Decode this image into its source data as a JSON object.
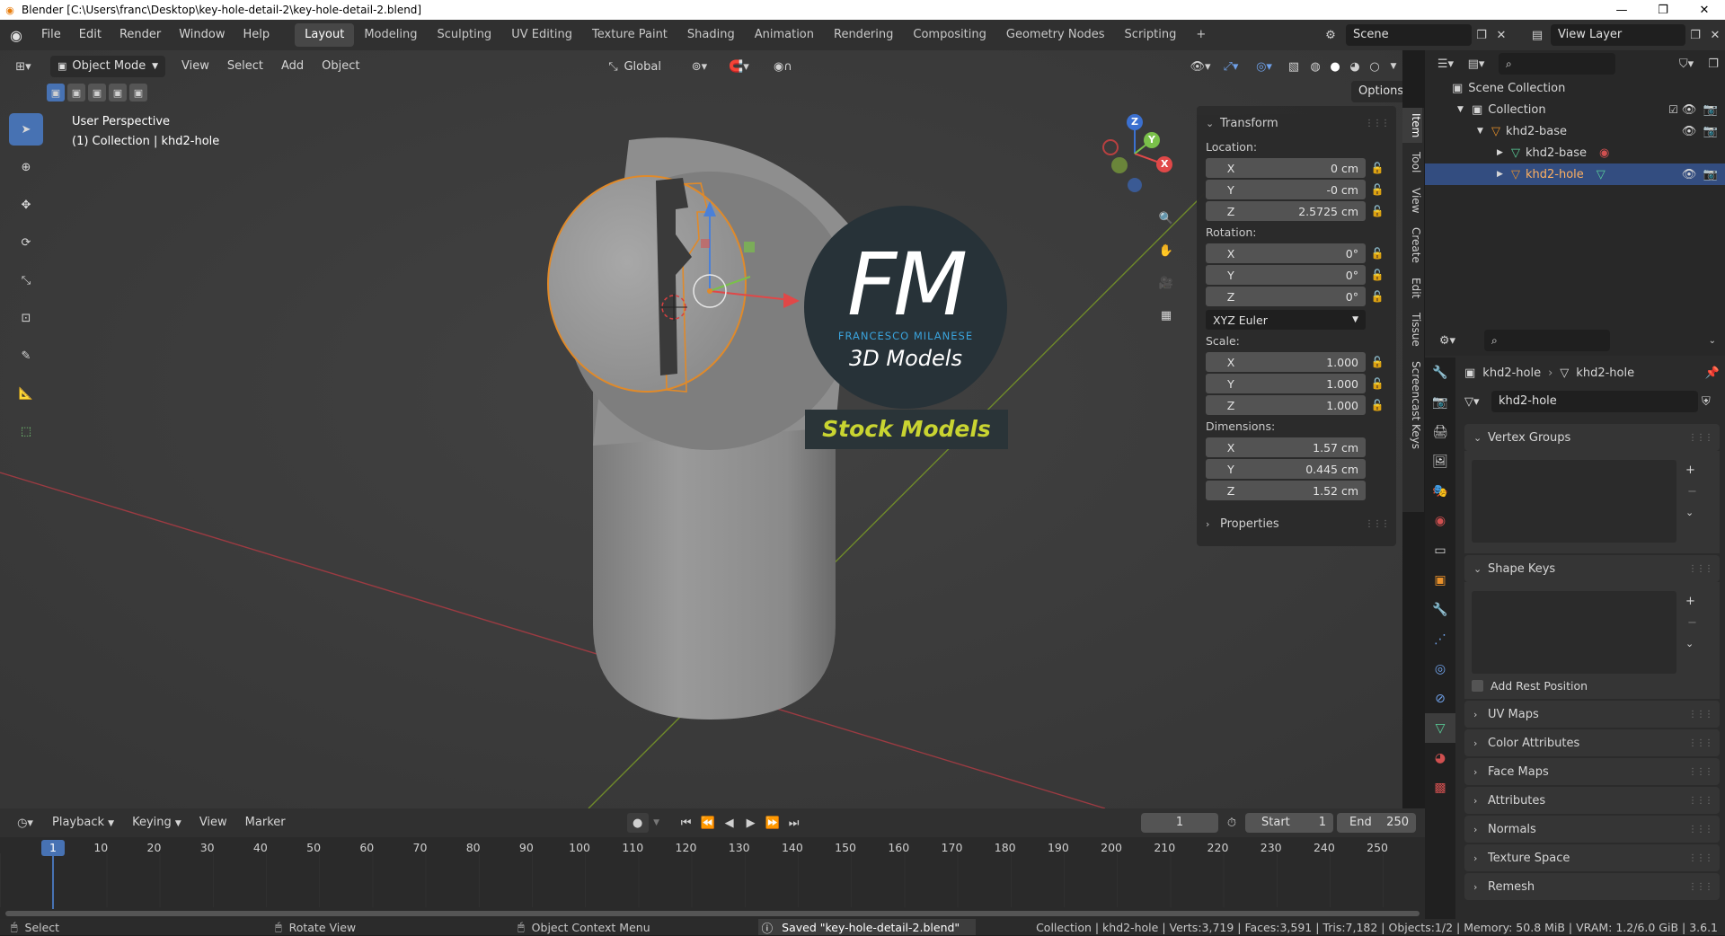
{
  "window": {
    "title": "Blender [C:\\Users\\franc\\Desktop\\key-hole-detail-2\\key-hole-detail-2.blend]",
    "minimize": "—",
    "maximize": "❐",
    "close": "✕"
  },
  "menus": [
    "File",
    "Edit",
    "Render",
    "Window",
    "Help"
  ],
  "workspaces": [
    "Layout",
    "Modeling",
    "Sculpting",
    "UV Editing",
    "Texture Paint",
    "Shading",
    "Animation",
    "Rendering",
    "Compositing",
    "Geometry Nodes",
    "Scripting"
  ],
  "add_workspace": "+",
  "scene": {
    "name": "Scene",
    "view_layer": "View Layer"
  },
  "viewport": {
    "mode": "Object Mode",
    "menus": [
      "View",
      "Select",
      "Add",
      "Object"
    ],
    "transform_orientation": "Global",
    "options_label": "Options",
    "perspective_label": "User Perspective",
    "collection_label": "(1) Collection | khd2-hole",
    "gizmo_axes": {
      "x": "X",
      "y": "Y",
      "z": "Z"
    }
  },
  "watermark": {
    "monogram": "FM",
    "name": "FRANCESCO MILANESE",
    "line": "3D Models",
    "banner": "Stock Models"
  },
  "npanel": {
    "tabs": [
      "Item",
      "Tool",
      "View",
      "Create",
      "Edit",
      "Tissue",
      "Screencast Keys"
    ],
    "section": "Transform",
    "location_label": "Location:",
    "location": [
      {
        "axis": "X",
        "value": "0 cm"
      },
      {
        "axis": "Y",
        "value": "-0 cm"
      },
      {
        "axis": "Z",
        "value": "2.5725 cm"
      }
    ],
    "rotation_label": "Rotation:",
    "rotation": [
      {
        "axis": "X",
        "value": "0°"
      },
      {
        "axis": "Y",
        "value": "0°"
      },
      {
        "axis": "Z",
        "value": "0°"
      }
    ],
    "rotation_mode": "XYZ Euler",
    "scale_label": "Scale:",
    "scale": [
      {
        "axis": "X",
        "value": "1.000"
      },
      {
        "axis": "Y",
        "value": "1.000"
      },
      {
        "axis": "Z",
        "value": "1.000"
      }
    ],
    "dimensions_label": "Dimensions:",
    "dimensions": [
      {
        "axis": "X",
        "value": "1.57 cm"
      },
      {
        "axis": "Y",
        "value": "0.445 cm"
      },
      {
        "axis": "Z",
        "value": "1.52 cm"
      }
    ],
    "properties_section": "Properties"
  },
  "outliner": {
    "items": [
      {
        "label": "Scene Collection"
      },
      {
        "label": "Collection"
      },
      {
        "label": "khd2-base"
      },
      {
        "label": "khd2-base"
      },
      {
        "label": "khd2-hole"
      }
    ]
  },
  "properties": {
    "breadcrumb_object": "khd2-hole",
    "breadcrumb_data": "khd2-hole",
    "data_name": "khd2-hole",
    "panels": {
      "vertex_groups": "Vertex Groups",
      "shape_keys": "Shape Keys",
      "add_rest_position": "Add Rest Position",
      "uv_maps": "UV Maps",
      "color_attributes": "Color Attributes",
      "face_maps": "Face Maps",
      "attributes": "Attributes",
      "normals": "Normals",
      "texture_space": "Texture Space",
      "remesh": "Remesh"
    }
  },
  "timeline": {
    "menus": [
      "Playback",
      "Keying",
      "View",
      "Marker"
    ],
    "current_frame": "1",
    "start_label": "Start",
    "start": "1",
    "end_label": "End",
    "end": "250",
    "ticks": [
      "1",
      "10",
      "20",
      "30",
      "40",
      "50",
      "60",
      "70",
      "80",
      "90",
      "100",
      "110",
      "120",
      "130",
      "140",
      "150",
      "160",
      "170",
      "180",
      "190",
      "200",
      "210",
      "220",
      "230",
      "240",
      "250"
    ]
  },
  "statusbar": {
    "select": "Select",
    "rotate": "Rotate View",
    "context_menu": "Object Context Menu",
    "saved": "Saved \"key-hole-detail-2.blend\"",
    "stats": "Collection | khd2-hole | Verts:3,719 | Faces:3,591 | Tris:7,182 | Objects:1/2 | Memory: 50.8 MiB | VRAM: 1.2/6.0 GiB | 3.6.1"
  }
}
